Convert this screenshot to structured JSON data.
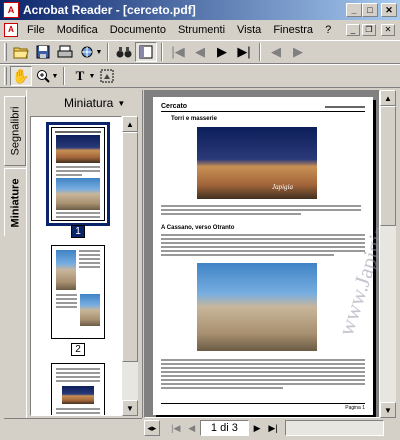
{
  "window": {
    "title": "Acrobat Reader - [cerceto.pdf]",
    "app_icon_glyph": "A"
  },
  "window_controls": {
    "minimize": "_",
    "maximize": "□",
    "close": "✕"
  },
  "menubar": {
    "items": [
      "File",
      "Modifica",
      "Documento",
      "Strumenti",
      "Vista",
      "Finestra",
      "?"
    ]
  },
  "mdi_controls": {
    "minimize": "_",
    "restore": "❐",
    "close": "✕"
  },
  "sidebar": {
    "tabs": [
      "Segnalibri",
      "Miniature"
    ],
    "panel_title": "Miniatura",
    "thumbnail_labels": [
      "1",
      "2"
    ]
  },
  "document": {
    "header_left": "Cercato",
    "section1_title": "Torri e masserie",
    "section2_title": "A Cassano, verso Otranto",
    "watermark": "www.Japigia.com",
    "photo_caption": "Japigia",
    "footer_right": "Pagina 1"
  },
  "status": {
    "page_display": "1 di 3"
  },
  "colors": {
    "title_gradient_start": "#0a246a",
    "title_gradient_end": "#a6caf0",
    "selection": "#0a246a",
    "doc_background": "#808080"
  }
}
